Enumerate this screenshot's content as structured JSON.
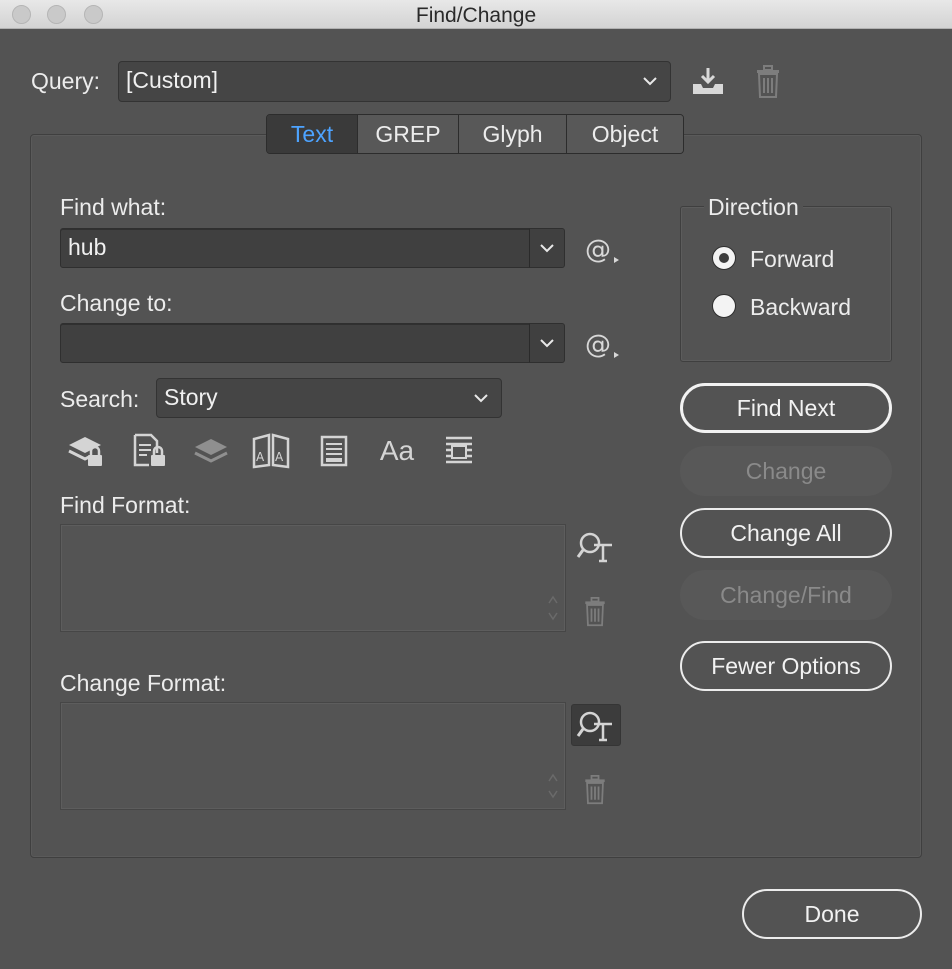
{
  "window": {
    "title": "Find/Change"
  },
  "query": {
    "label": "Query:",
    "value": "[Custom]"
  },
  "tabs": [
    {
      "label": "Text",
      "active": true
    },
    {
      "label": "GREP",
      "active": false
    },
    {
      "label": "Glyph",
      "active": false
    },
    {
      "label": "Object",
      "active": false
    }
  ],
  "find_what": {
    "label": "Find what:",
    "value": "hub"
  },
  "change_to": {
    "label": "Change to:",
    "value": ""
  },
  "search": {
    "label": "Search:",
    "value": "Story"
  },
  "option_icons": [
    "locked-layers-icon",
    "locked-stories-icon",
    "hidden-layers-icon",
    "master-pages-icon",
    "footnotes-icon",
    "case-sensitive-icon",
    "whole-word-icon"
  ],
  "option_icon_texts": {
    "case_sensitive": "Aa"
  },
  "find_format": {
    "label": "Find Format:"
  },
  "change_format": {
    "label": "Change Format:"
  },
  "direction": {
    "label": "Direction",
    "forward": "Forward",
    "backward": "Backward",
    "selected": "Forward"
  },
  "buttons": {
    "find_next": "Find Next",
    "change": "Change",
    "change_all": "Change All",
    "change_find": "Change/Find",
    "fewer_options": "Fewer Options",
    "done": "Done"
  },
  "colors": {
    "accent": "#4da3ff",
    "panel_bg": "#535353",
    "field_bg": "#404040"
  }
}
